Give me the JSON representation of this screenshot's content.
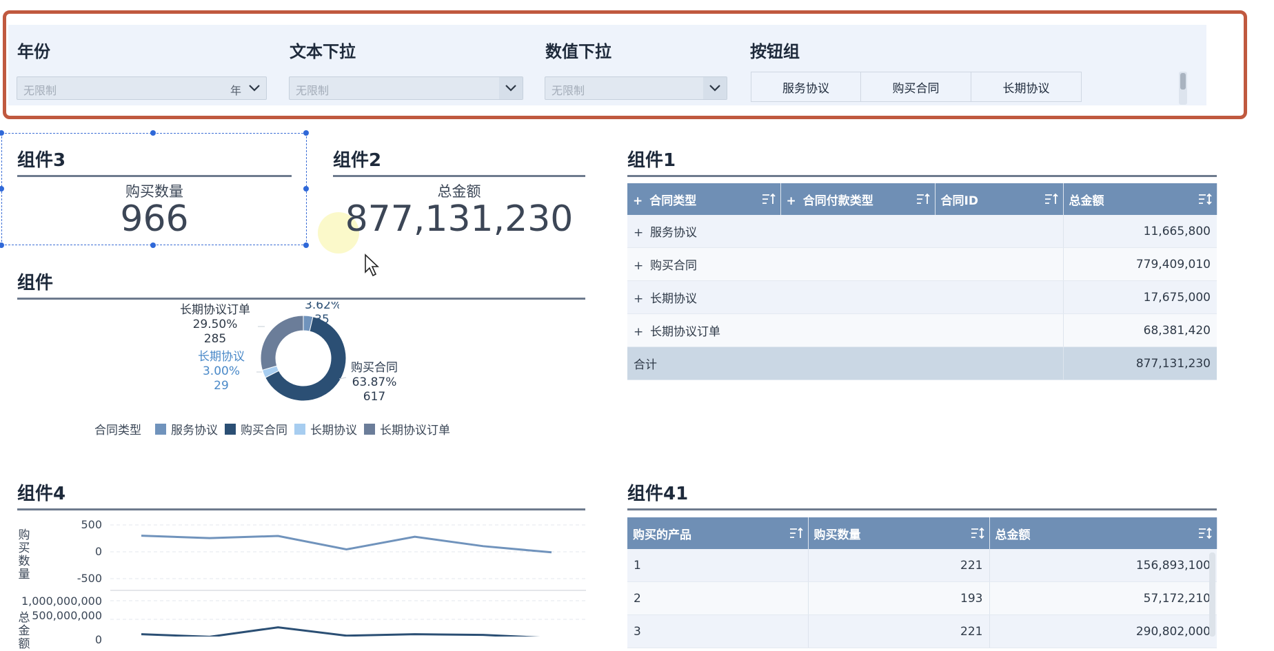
{
  "colors": {
    "service": "#7093bc",
    "purchase": "#2b4f74",
    "longterm": "#a7cdf0",
    "longterm_order": "#6b7d99",
    "header": "#6f8fb5",
    "frame": "#c0593f"
  },
  "filters": {
    "year": {
      "label": "年份",
      "placeholder": "无限制",
      "unit": "年"
    },
    "text_dropdown": {
      "label": "文本下拉",
      "placeholder": "无限制"
    },
    "number_dropdown": {
      "label": "数值下拉",
      "placeholder": "无限制"
    },
    "button_group": {
      "label": "按钮组",
      "buttons": [
        "服务协议",
        "购买合同",
        "长期协议"
      ]
    }
  },
  "widget3": {
    "title": "组件3",
    "kpi_label": "购买数量",
    "kpi_value": "966"
  },
  "widget2": {
    "title": "组件2",
    "kpi_label": "总金额",
    "kpi_value": "877,131,230"
  },
  "widget": {
    "title": "组件",
    "chart_data": {
      "type": "pie",
      "title": "",
      "legend_title": "合同类型",
      "legend_position": "bottom",
      "categories": [
        "服务协议",
        "购买合同",
        "长期协议",
        "长期协议订单"
      ],
      "values": [
        35,
        617,
        29,
        285
      ],
      "percent_labels": [
        "3.62%",
        "63.87%",
        "3.00%",
        "29.50%"
      ]
    }
  },
  "widget1": {
    "title": "组件1",
    "columns": [
      "合同类型",
      "合同付款类型",
      "合同ID",
      "总金额"
    ],
    "rows": [
      {
        "type": "服务协议",
        "amount": "11,665,800"
      },
      {
        "type": "购买合同",
        "amount": "779,409,010"
      },
      {
        "type": "长期协议",
        "amount": "17,675,000"
      },
      {
        "type": "长期协议订单",
        "amount": "68,381,420"
      }
    ],
    "total_label": "合计",
    "total_amount": "877,131,230"
  },
  "widget4": {
    "title": "组件4",
    "chart_data": [
      {
        "type": "line",
        "ylabel": "购买数量",
        "yticks": [
          "500",
          "0",
          "-500"
        ],
        "ylim": [
          -500,
          500
        ],
        "values": [
          300,
          255,
          295,
          45,
          280,
          105,
          -10
        ]
      },
      {
        "type": "line",
        "ylabel": "总金额",
        "yticks": [
          "1,000,000,000",
          "500,000,000",
          "0"
        ],
        "ylim": [
          0,
          1000000000
        ],
        "values": [
          100000000,
          30000000,
          285000000,
          60000000,
          100000000,
          80000000,
          -5000000
        ]
      }
    ]
  },
  "widget41": {
    "title": "组件41",
    "columns": [
      "购买的产品",
      "购买数量",
      "总金额"
    ],
    "rows": [
      {
        "product": "1",
        "qty": "221",
        "amount": "156,893,100"
      },
      {
        "product": "2",
        "qty": "193",
        "amount": "57,172,210"
      },
      {
        "product": "3",
        "qty": "221",
        "amount": "290,802,000"
      }
    ]
  }
}
